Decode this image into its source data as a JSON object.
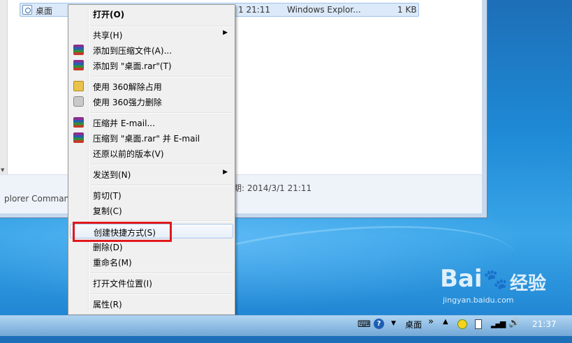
{
  "explorer": {
    "file_name": "桌面",
    "file_modified_partial": "1 21:11",
    "file_type": "Windows Explor...",
    "file_size": "1 KB",
    "status_left": "plorer Comman",
    "status_date": "期: 2014/3/1 21:11"
  },
  "context_menu": {
    "items": [
      {
        "label": "打开(O)",
        "icon": null
      },
      {
        "label": "共享(H)",
        "icon": null,
        "submenu": true
      },
      {
        "label": "添加到压缩文件(A)...",
        "icon": "winrar-icon"
      },
      {
        "label": "添加到 \"桌面.rar\"(T)",
        "icon": "winrar-icon"
      },
      {
        "label": "使用 360解除占用",
        "icon": "360-unlock-icon"
      },
      {
        "label": "使用 360强力删除",
        "icon": "360-shred-icon"
      },
      {
        "label": "压缩并 E-mail...",
        "icon": "winrar-icon"
      },
      {
        "label": "压缩到 \"桌面.rar\" 并 E-mail",
        "icon": "winrar-icon"
      },
      {
        "label": "还原以前的版本(V)",
        "icon": null
      },
      {
        "label": "发送到(N)",
        "icon": null,
        "submenu": true
      },
      {
        "label": "剪切(T)",
        "icon": null
      },
      {
        "label": "复制(C)",
        "icon": null
      },
      {
        "label": "创建快捷方式(S)",
        "icon": null,
        "highlighted": true
      },
      {
        "label": "删除(D)",
        "icon": null
      },
      {
        "label": "重命名(M)",
        "icon": null
      },
      {
        "label": "打开文件位置(I)",
        "icon": null
      },
      {
        "label": "属性(R)",
        "icon": null
      }
    ],
    "submenu_arrow": "▶"
  },
  "taskbar": {
    "desktop_label": "桌面",
    "expand_glyph": "»",
    "help_glyph": "?",
    "clock": "21:37"
  },
  "watermark": {
    "brand": "Bai",
    "brand2": "经验",
    "url": "jingyan.baidu.com"
  },
  "colors": {
    "highlight_box": "#e0181c",
    "menu_bg": "#f0f0f0"
  }
}
